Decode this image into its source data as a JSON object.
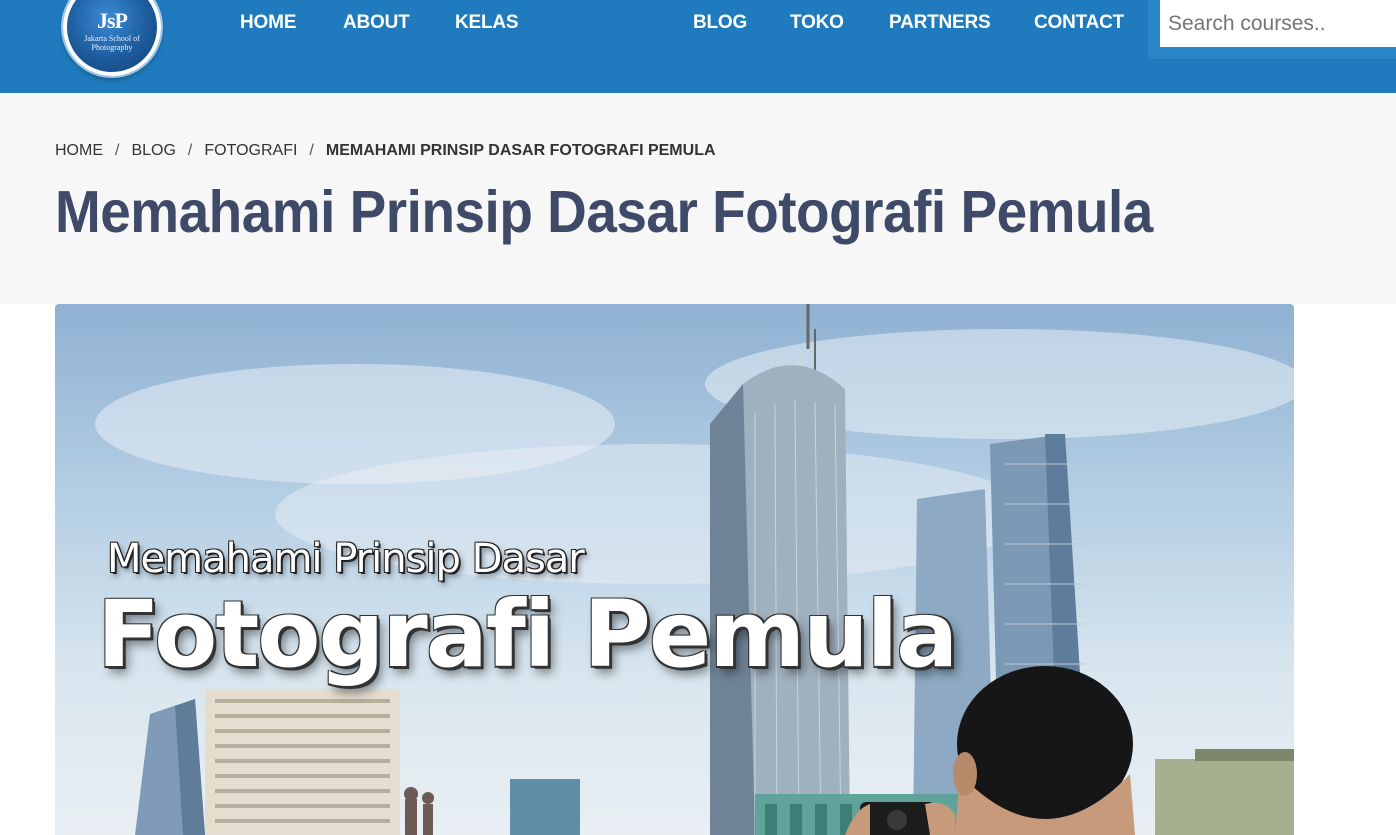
{
  "header": {
    "logo": {
      "mark": "JsP",
      "subtitle": "Jakarta School of Photography",
      "icon": "jsp-logo-icon"
    },
    "nav": [
      {
        "label": "HOME"
      },
      {
        "label": "ABOUT"
      },
      {
        "label": "KELAS"
      },
      {
        "label": "BLOG"
      },
      {
        "label": "TOKO"
      },
      {
        "label": "PARTNERS"
      },
      {
        "label": "CONTACT"
      }
    ],
    "search": {
      "placeholder": "Search courses..",
      "value": ""
    }
  },
  "breadcrumb": {
    "items": [
      "HOME",
      "BLOG",
      "FOTOGRAFI"
    ],
    "separator": "/",
    "current": "MEMAHAMI PRINSIP DASAR FOTOGRAFI PEMULA"
  },
  "page": {
    "title": "Memahami Prinsip Dasar Fotografi Pemula"
  },
  "hero": {
    "line1": "Memahami Prinsip Dasar",
    "line2": "Fotografi Pemula"
  },
  "colors": {
    "header_bg": "#1f7bbd",
    "title_text": "#3f4a68",
    "title_area_bg": "#f7f7f7"
  }
}
